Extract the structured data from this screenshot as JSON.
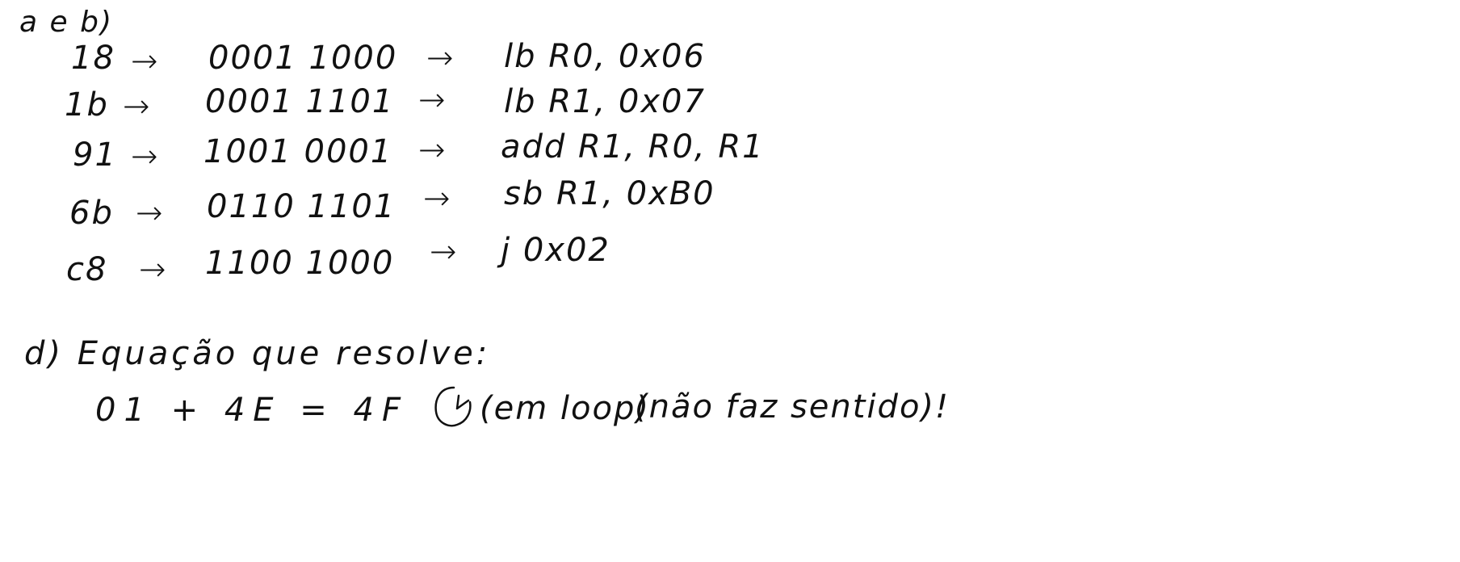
{
  "header": {
    "label": "a e b)"
  },
  "rows": [
    {
      "hex": "18",
      "arrow1": "→",
      "binary": "0001 1000",
      "arrow2": "→",
      "instr": "lb R0, 0x06"
    },
    {
      "hex": "1b",
      "arrow1": "→",
      "binary": "0001 1101",
      "arrow2": "→",
      "instr": "lb R1, 0x07"
    },
    {
      "hex": "91",
      "arrow1": "→",
      "binary": "1001 0001",
      "arrow2": "→",
      "instr": "add R1, R0, R1"
    },
    {
      "hex": "6b",
      "arrow1": "→",
      "binary": "0110 1101",
      "arrow2": "→",
      "instr": "sb R1, 0xB0"
    },
    {
      "hex": "c8",
      "arrow1": "→",
      "binary": "1100 1000",
      "arrow2": "→",
      "instr": "j 0x02"
    }
  ],
  "section_d": {
    "label": "d) Equação que resolve:",
    "equation": "01 + 4E = 4F",
    "note1": "(em loop)",
    "note2": "(não faz sentido)!"
  },
  "icons": {
    "loop": "loop-arrow-icon"
  },
  "colors": {
    "ink": "#111111",
    "background": "#ffffff"
  }
}
